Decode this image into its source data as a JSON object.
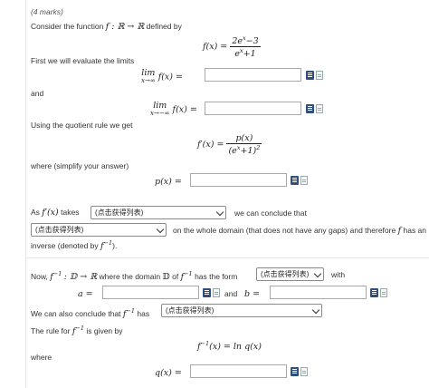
{
  "question": {
    "marks": "(4 marks)",
    "intro": "Consider the function",
    "func_sig": "f : ℝ → ℝ",
    "defined_by": "defined by",
    "f_lhs": "f(x) =",
    "f_num_a": "2e",
    "f_num_sup": "x",
    "f_num_b": "−3",
    "f_den_a": "e",
    "f_den_sup": "x",
    "f_den_b": "+1"
  },
  "limits": {
    "intro": "First we will evaluate the limits",
    "lim1_word": "lim",
    "lim1_sub": "x→∞",
    "lim1_expr": "f(x) =",
    "and": "and",
    "lim2_word": "lim",
    "lim2_sub": "x→−∞",
    "lim2_expr": "f(x) ="
  },
  "quotient": {
    "intro": "Using the quotient rule we get",
    "lhs": "f′(x) =",
    "num": "p(x)",
    "den_a": "(e",
    "den_sup1": "x",
    "den_b": "+1)",
    "den_sup2": "2",
    "simplify": "where (simplify your answer)",
    "p_lhs": "p(x) ="
  },
  "conclusion": {
    "as": "As",
    "fprime": "f′(x)",
    "takes": "takes",
    "select1": "(点击获得列表)",
    "conclude": "we can conclude that",
    "select2": "(点击获得列表)",
    "whole_domain": "on the whole domain (that does not have any gaps) and therefore",
    "f_sym": "f",
    "has_an": "has an",
    "inverse": "inverse (denoted by",
    "finv": "f",
    "finv_sup": "−1",
    "close": ")."
  },
  "inverse": {
    "now": "Now,",
    "finv": "f",
    "finv_sup": "−1",
    "map": ": 𝔻 → ℝ",
    "domain_text": "where the domain",
    "D": "𝔻",
    "of": "of",
    "form": "has the form",
    "select3": "(点击获得列表)",
    "with": "with",
    "a_lhs": "a =",
    "and": "and",
    "b_lhs": "b =",
    "also": "We can also conclude that",
    "has": "has",
    "select4": "(点击获得列表)",
    "rule": "The rule for",
    "given_by": "is given by",
    "rule_eq": "f",
    "rule_sup": "−1",
    "rule_rest": "(x) = ln q(x)",
    "where": "where",
    "q_lhs": "q(x) ="
  },
  "icons": {
    "formula": "formula-editor-icon",
    "help": "help-doc-icon"
  }
}
